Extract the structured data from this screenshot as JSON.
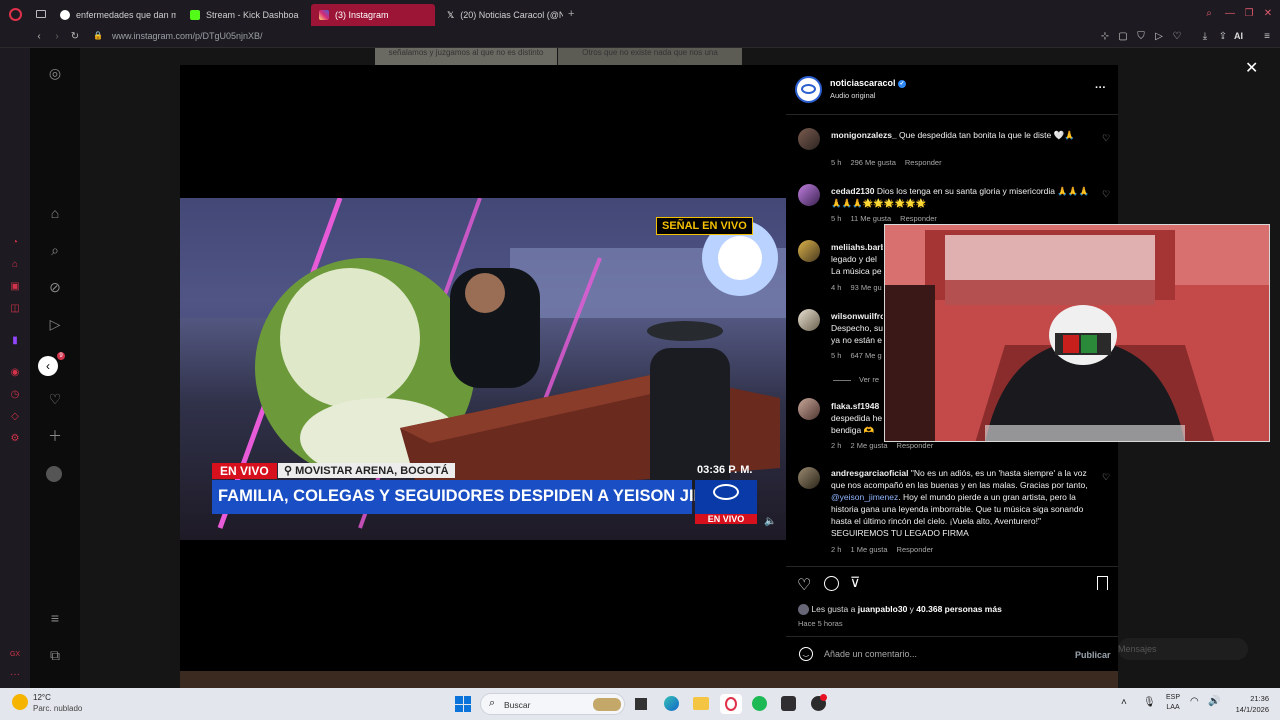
{
  "browser": {
    "tabs": [
      {
        "title": "enfermedades que dan m",
        "favicon_color": "#4285f4"
      },
      {
        "title": "Stream - Kick Dashboa",
        "favicon_color": "#53fc18"
      },
      {
        "title": "(3) Instagram",
        "favicon_color": "#e1306c",
        "active": true
      },
      {
        "title": "(20) Noticias Caracol (@N",
        "favicon_color": "#ffffff"
      }
    ],
    "new_tab": "+",
    "url": "www.instagram.com/p/DTgU05njnXB/",
    "ai_label": "AI",
    "sidebar_badge": "9"
  },
  "background_page": {
    "snippet_1": "señalamos y juzgamos al que no es distinto",
    "snippet_2": "Otros que no existe nada que nos una"
  },
  "video": {
    "live_badge": "SEÑAL EN VIVO",
    "lower_third_live": "EN VIVO",
    "location": "MOVISTAR ARENA, BOGOTÁ",
    "time": "03:36 P. M.",
    "headline": "FAMILIA, COLEGAS Y SEGUIDORES DESPIDEN A YEISON JIMÉNEZ",
    "logo_live": "EN VIVO",
    "mute_icon": "speaker-icon"
  },
  "post": {
    "author": "noticiascaracol",
    "audio": "Audio original",
    "more": "···",
    "close": "✕",
    "comments": [
      {
        "user": "monigonzalezs_",
        "text": "Que despedida tan bonita la que le diste 🤍🙏",
        "age": "5 h",
        "likes": "296 Me gusta",
        "reply": "Responder"
      },
      {
        "user": "cedad2130",
        "text": "Dios los tenga en su santa gloria y misericordia 🙏🙏🙏🙏🙏🙏🌟🌟🌟🌟🌟🌟",
        "age": "5 h",
        "likes": "11 Me gusta",
        "reply": "Responder"
      },
      {
        "user": "meliiahs.barb",
        "text": "legado y del",
        "text2": "La música pe",
        "age": "4 h",
        "likes": "93 Me gu",
        "reply": ""
      },
      {
        "user": "wilsonwuilfro",
        "text": "Despecho, su",
        "text2": "ya no están e",
        "age": "5 h",
        "likes": "647 Me g",
        "reply": ""
      },
      {
        "user": "flaka.sf1948",
        "text": "despedida he",
        "text2": "bendiga 🫶",
        "age": "2 h",
        "likes": "2 Me gusta",
        "reply": "Responder"
      },
      {
        "user": "andresgarciaoficial",
        "text": "\"No es un adiós, es un 'hasta siempre' a la voz que nos acompañó en las buenas y en las malas. Gracias por tanto,",
        "mention": "@yeison_jimenez",
        "text_after": ". Hoy el mundo pierde a un gran artista, pero la historia gana una leyenda imborrable. Que tu música siga sonando hasta el último rincón del cielo. ¡Vuela alto, Aventurero!\" SEGUIREMOS TU LEGADO FIRMA",
        "age": "2 h",
        "likes": "1 Me gusta",
        "reply": "Responder"
      }
    ],
    "view_replies": "Ver re",
    "likes_prefix": "Les gusta a",
    "likes_user": "juanpablo30",
    "likes_and": "y",
    "likes_count": "40.368 personas más",
    "posted": "Hace 5 horas",
    "comment_placeholder": "Añade un comentario...",
    "publish": "Publicar",
    "messages": "Mensajes"
  },
  "taskbar": {
    "weather_temp": "12°C",
    "weather_desc": "Parc. nublado",
    "search": "Buscar",
    "lang1": "ESP",
    "lang2": "LAA",
    "time": "21:36",
    "date": "14/1/2026"
  }
}
